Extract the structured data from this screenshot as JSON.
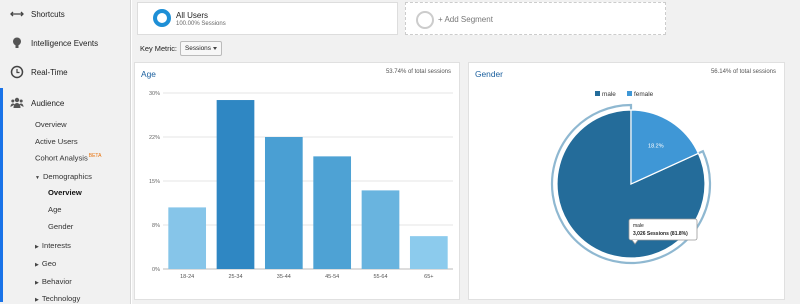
{
  "sidebar": {
    "items": [
      {
        "label": "Shortcuts",
        "icon": "shortcuts-icon"
      },
      {
        "label": "Intelligence Events",
        "icon": "lightbulb-icon"
      },
      {
        "label": "Real-Time",
        "icon": "clock-icon"
      },
      {
        "label": "Audience",
        "icon": "audience-icon"
      }
    ],
    "audience_sub": {
      "overview": "Overview",
      "active_users": "Active Users",
      "cohort_analysis": "Cohort Analysis",
      "beta": "BETA",
      "demographics": "Demographics",
      "demo_overview": "Overview",
      "demo_age": "Age",
      "demo_gender": "Gender",
      "interests": "Interests",
      "geo": "Geo",
      "behavior": "Behavior",
      "technology": "Technology"
    }
  },
  "segments": {
    "all_users_title": "All Users",
    "all_users_sub": "100.00% Sessions",
    "add_segment": "+ Add Segment"
  },
  "key_metric": {
    "label": "Key Metric:",
    "value": "Sessions"
  },
  "age_panel": {
    "title": "Age",
    "note": "53.74% of total sessions"
  },
  "gender_panel": {
    "title": "Gender",
    "note": "56.14% of total sessions",
    "tooltip_line1": "male",
    "tooltip_line2": "3,026 Sessions (81.8%)",
    "slice_label": "18.2%"
  },
  "colors": {
    "accent": "#1a73e8",
    "male": "#246c9a",
    "female": "#3f97d6",
    "bar_light": "#7ec3e8",
    "bar_dark": "#2b86c4"
  },
  "chart_data": [
    {
      "type": "bar",
      "title": "Age",
      "categories": [
        "18-24",
        "25-34",
        "35-44",
        "45-54",
        "55-64",
        "65+"
      ],
      "values": [
        10.5,
        28.8,
        22.5,
        19.2,
        13.4,
        5.6
      ],
      "colors": [
        "#86c5e9",
        "#2f87c3",
        "#4a9fd3",
        "#4ea2d4",
        "#69b4df",
        "#8ccbed"
      ],
      "yticks": [
        "0%",
        "8%",
        "15%",
        "22%",
        "30%"
      ],
      "ylim": [
        0,
        30
      ],
      "grid": true
    },
    {
      "type": "pie",
      "title": "Gender",
      "labels": [
        "male",
        "female"
      ],
      "values": [
        81.8,
        18.2
      ],
      "colors": [
        "#246c9a",
        "#3f97d6"
      ],
      "legend": "top"
    }
  ]
}
